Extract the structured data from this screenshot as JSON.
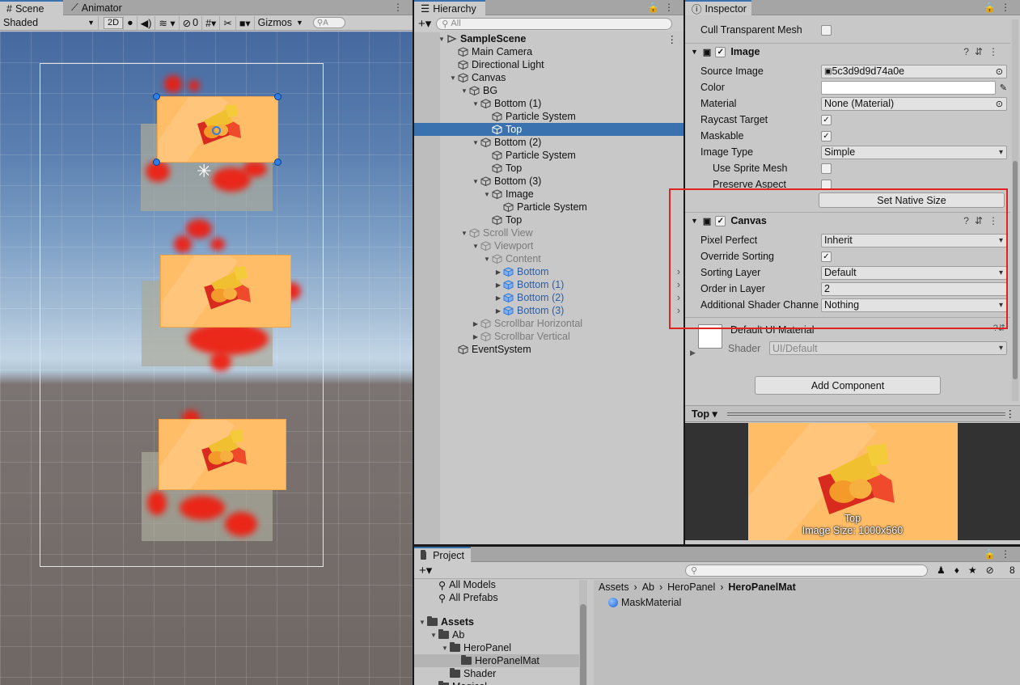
{
  "scene": {
    "tabs": [
      {
        "label": "Scene",
        "icon": "grid-icon"
      },
      {
        "label": "Animator",
        "icon": "animator-icon"
      }
    ],
    "toolbar": {
      "draw_mode": "Shaded",
      "mode_2d": "2D",
      "hidden_count": "0",
      "gizmos": "Gizmos",
      "search_placeholder": "A"
    }
  },
  "hierarchy": {
    "tab": "Hierarchy",
    "search_placeholder": "All",
    "rows": [
      {
        "label": "SampleScene",
        "depth": 0,
        "arrow": "▼",
        "style": "scene"
      },
      {
        "label": "Main Camera",
        "depth": 1,
        "arrow": "",
        "style": ""
      },
      {
        "label": "Directional Light",
        "depth": 1,
        "arrow": "",
        "style": ""
      },
      {
        "label": "Canvas",
        "depth": 1,
        "arrow": "▼",
        "style": ""
      },
      {
        "label": "BG",
        "depth": 2,
        "arrow": "▼",
        "style": ""
      },
      {
        "label": "Bottom (1)",
        "depth": 3,
        "arrow": "▼",
        "style": ""
      },
      {
        "label": "Particle System",
        "depth": 4,
        "arrow": "",
        "style": ""
      },
      {
        "label": "Top",
        "depth": 4,
        "arrow": "",
        "style": "sel"
      },
      {
        "label": "Bottom (2)",
        "depth": 3,
        "arrow": "▼",
        "style": ""
      },
      {
        "label": "Particle System",
        "depth": 4,
        "arrow": "",
        "style": ""
      },
      {
        "label": "Top",
        "depth": 4,
        "arrow": "",
        "style": ""
      },
      {
        "label": "Bottom (3)",
        "depth": 3,
        "arrow": "▼",
        "style": ""
      },
      {
        "label": "Image",
        "depth": 4,
        "arrow": "▼",
        "style": ""
      },
      {
        "label": "Particle System",
        "depth": 5,
        "arrow": "",
        "style": ""
      },
      {
        "label": "Top",
        "depth": 4,
        "arrow": "",
        "style": ""
      },
      {
        "label": "Scroll View",
        "depth": 2,
        "arrow": "▼",
        "style": "dis"
      },
      {
        "label": "Viewport",
        "depth": 3,
        "arrow": "▼",
        "style": "dis"
      },
      {
        "label": "Content",
        "depth": 4,
        "arrow": "▼",
        "style": "dis"
      },
      {
        "label": "Bottom",
        "depth": 5,
        "arrow": "▶",
        "style": "pre"
      },
      {
        "label": "Bottom (1)",
        "depth": 5,
        "arrow": "▶",
        "style": "pre"
      },
      {
        "label": "Bottom (2)",
        "depth": 5,
        "arrow": "▶",
        "style": "pre"
      },
      {
        "label": "Bottom (3)",
        "depth": 5,
        "arrow": "▶",
        "style": "pre"
      },
      {
        "label": "Scrollbar Horizontal",
        "depth": 3,
        "arrow": "▶",
        "style": "dis"
      },
      {
        "label": "Scrollbar Vertical",
        "depth": 3,
        "arrow": "▶",
        "style": "dis"
      },
      {
        "label": "EventSystem",
        "depth": 1,
        "arrow": "",
        "style": ""
      }
    ]
  },
  "inspector": {
    "tab": "Inspector",
    "cull_label": "Cull Transparent Mesh",
    "image": {
      "title": "Image",
      "fields": [
        {
          "label": "Source Image",
          "value": "5c3d9d9d74a0e",
          "kind": "object"
        },
        {
          "label": "Color",
          "value": "",
          "kind": "color"
        },
        {
          "label": "Material",
          "value": "None (Material)",
          "kind": "object"
        },
        {
          "label": "Raycast Target",
          "value": "✓",
          "kind": "check"
        },
        {
          "label": "Maskable",
          "value": "✓",
          "kind": "check"
        },
        {
          "label": "Image Type",
          "value": "Simple",
          "kind": "drop"
        },
        {
          "label": "Use Sprite Mesh",
          "value": "",
          "kind": "check",
          "indent": true
        },
        {
          "label": "Preserve Aspect",
          "value": "",
          "kind": "check",
          "indent": true
        }
      ],
      "native_size_button": "Set Native Size"
    },
    "canvas": {
      "title": "Canvas",
      "fields": [
        {
          "label": "Pixel Perfect",
          "value": "Inherit",
          "kind": "drop"
        },
        {
          "label": "Override Sorting",
          "value": "✓",
          "kind": "check"
        },
        {
          "label": "Sorting Layer",
          "value": "Default",
          "kind": "drop"
        },
        {
          "label": "Order in Layer",
          "value": "2",
          "kind": "text"
        },
        {
          "label": "Additional Shader Channe",
          "value": "Nothing",
          "kind": "drop"
        }
      ]
    },
    "material": {
      "name": "Default UI Material",
      "shader_label": "Shader",
      "shader_value": "UI/Default"
    },
    "add_component": "Add Component",
    "preview": {
      "title": "Top",
      "name": "Top",
      "size": "Image Size: 1000x560"
    }
  },
  "project": {
    "tab": "Project",
    "favorites": [
      "All Models",
      "All Prefabs"
    ],
    "tree": [
      {
        "label": "Assets",
        "depth": 0,
        "arrow": "▼",
        "bold": true
      },
      {
        "label": "Ab",
        "depth": 1,
        "arrow": "▼",
        "bold": false
      },
      {
        "label": "HeroPanel",
        "depth": 2,
        "arrow": "▼",
        "bold": false
      },
      {
        "label": "HeroPanelMat",
        "depth": 3,
        "arrow": "",
        "bold": false
      },
      {
        "label": "Shader",
        "depth": 2,
        "arrow": "",
        "bold": false
      },
      {
        "label": "Magical",
        "depth": 1,
        "arrow": "▼",
        "bold": false
      }
    ],
    "breadcrumb": [
      "Assets",
      "Ab",
      "HeroPanel",
      "HeroPanelMat"
    ],
    "items": [
      "MaskMaterial"
    ],
    "hidden_count": "8"
  },
  "colors": {
    "selection": "#3a72b0",
    "highlight_box": "#e0231e",
    "ui_panel": "#c8c8c8"
  }
}
